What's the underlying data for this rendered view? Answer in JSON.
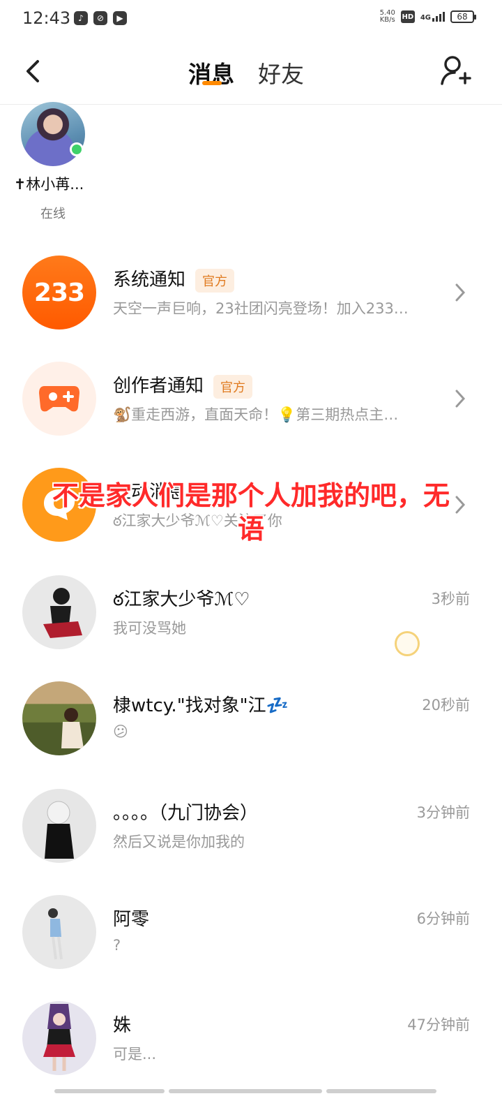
{
  "status_bar": {
    "time": "12:43",
    "net_speed_value": "5.40",
    "net_speed_unit": "KB/s",
    "hd": "HD",
    "net_type": "4G",
    "battery": "68"
  },
  "header": {
    "tabs": [
      {
        "label": "消息",
        "active": true
      },
      {
        "label": "好友",
        "active": false
      }
    ]
  },
  "online_friend": {
    "name": "✝林小苒...",
    "status": "在线"
  },
  "messages": [
    {
      "title": "系统通知",
      "badge": "官方",
      "preview": "天空一声巨响，23社团闪亮登场！加入233…",
      "avatar_text": "233"
    },
    {
      "title": "创作者通知",
      "badge": "官方",
      "preview": "🐒重走西游，直面天命！💡第三期热点主…"
    },
    {
      "title": "互动消息",
      "preview": "ఠ江家大少爷ℳ♡关注了你"
    },
    {
      "title": "ఠ江家大少爷ℳ♡",
      "preview": "我可没骂她",
      "time": "3秒前"
    },
    {
      "title": "棣wtcy.\"找对象\"江💤",
      "preview": "😕",
      "time": "20秒前"
    },
    {
      "title": "。。。。（九门协会）",
      "preview": "然后又说是你加我的",
      "time": "3分钟前"
    },
    {
      "title": "阿零",
      "preview": "?",
      "time": "6分钟前"
    },
    {
      "title": "姝",
      "preview": "可是...",
      "time": "47分钟前"
    }
  ],
  "overlay_caption": "不是家人们是那个人加我的吧，无语",
  "colors": {
    "accent": "#ff8a00",
    "online": "#3fd16a",
    "official_badge_text": "#e07a1f",
    "caption": "#ff2a2a"
  }
}
